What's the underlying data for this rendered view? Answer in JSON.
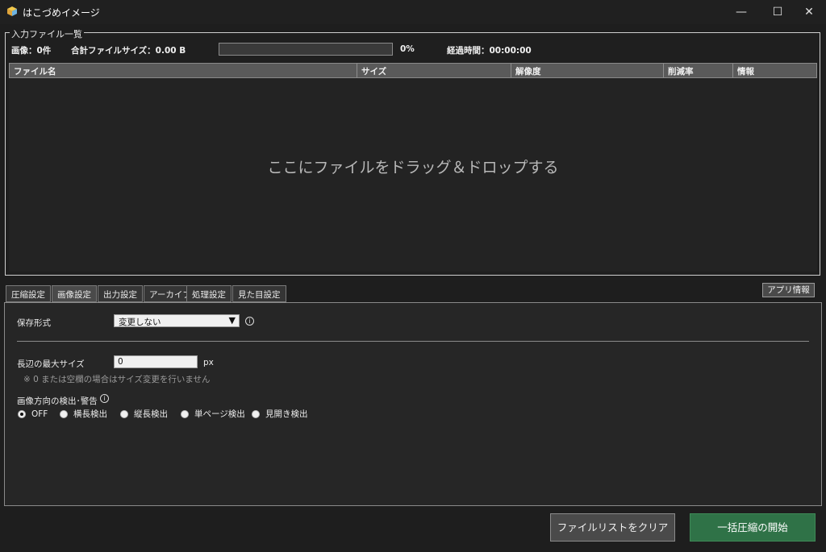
{
  "window": {
    "title": "はこづめイメージ",
    "controls": {
      "minimize": "—",
      "maximize": "☐",
      "close": "✕"
    }
  },
  "file_list": {
    "group_title": "入力ファイル一覧",
    "image_count": "画像：0件",
    "total_size": "合計ファイルサイズ：0.00 B",
    "progress": 0,
    "progress_text": "0%",
    "elapsed": "経過時間：00:00:00",
    "columns": [
      "ファイル名",
      "サイズ",
      "解像度",
      "削減率",
      "情報"
    ],
    "drop_hint": "ここにファイルをドラッグ＆ドロップする"
  },
  "tabs": {
    "items": [
      "圧縮設定",
      "画像設定",
      "出力設定",
      "アーカイブ",
      "処理設定",
      "見た目設定"
    ],
    "active_index": 1,
    "app_info": "アプリ情報"
  },
  "image_settings": {
    "save_format_label": "保存形式",
    "save_format_value": "変更しない",
    "max_side_label": "長辺の最大サイズ",
    "max_side_value": "0",
    "max_side_unit": "px",
    "max_side_note": "※ 0 または空欄の場合はサイズ変更を行いません",
    "orientation_label": "画像方向の検出･警告",
    "orientation_options": [
      "OFF",
      "横長検出",
      "縦長検出",
      "単ページ検出",
      "見開き検出"
    ],
    "orientation_selected": 0
  },
  "actions": {
    "clear_list": "ファイルリストをクリア",
    "start": "一括圧縮の開始"
  },
  "colors": {
    "start_button": "#2f7247",
    "progress_fill": "#3b9a4f"
  }
}
